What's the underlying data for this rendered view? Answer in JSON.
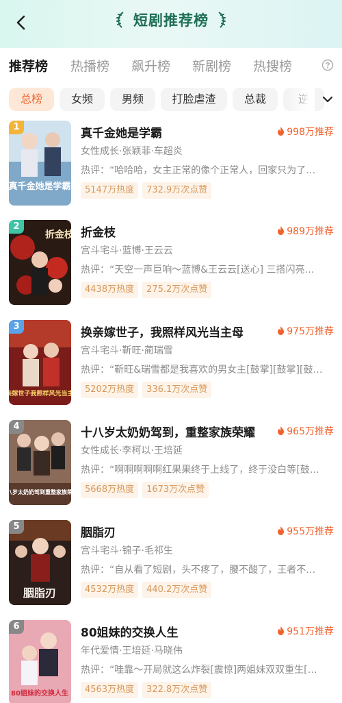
{
  "header": {
    "title": "短剧推荐榜",
    "colors": {
      "accent": "#f0632e",
      "title": "#1e6e55"
    },
    "icons": [
      "back-arrow-icon",
      "laurel-left-icon",
      "laurel-right-icon"
    ]
  },
  "tabs": [
    {
      "label": "推荐榜",
      "active": true
    },
    {
      "label": "热播榜",
      "active": false
    },
    {
      "label": "飙升榜",
      "active": false
    },
    {
      "label": "新剧榜",
      "active": false
    },
    {
      "label": "热搜榜",
      "active": false
    }
  ],
  "help_icon": "question-circle-icon",
  "chips": [
    {
      "label": "总榜",
      "active": true
    },
    {
      "label": "女频",
      "active": false
    },
    {
      "label": "男频",
      "active": false
    },
    {
      "label": "打脸虐渣",
      "active": false
    },
    {
      "label": "总裁",
      "active": false
    },
    {
      "label": "逆",
      "active": false
    }
  ],
  "expand_icon": "chevron-down-icon",
  "items": [
    {
      "rank": "1",
      "rank_color": "#f3b43a",
      "title": "真千金她是学霸",
      "recommend": "998万推荐",
      "meta": "女性成长·张颖菲·车超炎",
      "review": "热评：“哈哈哈，女主正常的像个正常人，回家只为了…",
      "heat": "5147万热度",
      "likes": "732.9万次点赞",
      "poster_caption": "真千金她是学霸"
    },
    {
      "rank": "2",
      "rank_color": "#3fc4a6",
      "title": "折金枝",
      "recommend": "989万推荐",
      "meta": "宫斗宅斗·蓝博·王云云",
      "review": "热评：“天空一声巨响～蓝博&王云云[送心] 三搭闪亮…",
      "heat": "4438万热度",
      "likes": "275.2万次点赞",
      "poster_caption": "折金枝"
    },
    {
      "rank": "3",
      "rank_color": "#5aa3e8",
      "title": "换亲嫁世子，我照样风光当主母",
      "recommend": "975万推荐",
      "meta": "宫斗宅斗·靳旺·蔺瑞雪",
      "review": "热评：“靳旺&瑞雪都是我喜欢的男女主[鼓掌][鼓掌][鼓…",
      "heat": "5202万热度",
      "likes": "336.1万次点赞",
      "poster_caption": "换亲嫁世子我照样风光当主母"
    },
    {
      "rank": "4",
      "rank_color": "#888888",
      "title": "十八岁太奶奶驾到，重整家族荣耀",
      "recommend": "965万推荐",
      "meta": "女性成长·李柯以·王培延",
      "review": "热评：“啊啊啊啊啊红果果终于上线了，终于没白等[鼓…",
      "heat": "5668万热度",
      "likes": "1673万次点赞",
      "poster_caption": "十八岁太奶奶驾到重整家族荣耀"
    },
    {
      "rank": "5",
      "rank_color": "#888888",
      "title": "胭脂刃",
      "recommend": "955万推荐",
      "meta": "宫斗宅斗·锦子·毛祁生",
      "review": "热评：“自从看了短剧，头不疼了，腰不酸了，王者不…",
      "heat": "4532万热度",
      "likes": "440.2万次点赞",
      "poster_caption": "胭脂刃"
    },
    {
      "rank": "6",
      "rank_color": "#888888",
      "title": "80姐妹的交换人生",
      "recommend": "951万推荐",
      "meta": "年代爱情·王培延·马晓伟",
      "review": "热评：“哇靠～开局就这么炸裂[震惊]两姐妹双双重生[…",
      "heat": "4563万热度",
      "likes": "322.8万次点赞",
      "poster_caption": "80姐妹的交换人生"
    }
  ]
}
